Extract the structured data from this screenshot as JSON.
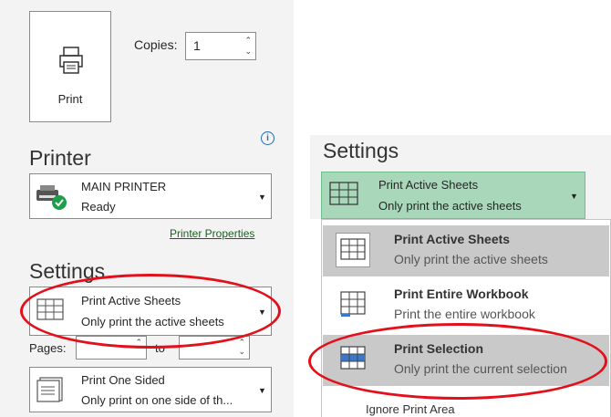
{
  "left": {
    "print_button_label": "Print",
    "copies_label": "Copies:",
    "copies_value": "1",
    "printer_heading": "Printer",
    "printer_name": "MAIN PRINTER",
    "printer_status": "Ready",
    "printer_properties_link": "Printer Properties",
    "settings_heading": "Settings",
    "active_sheets_title": "Print Active Sheets",
    "active_sheets_desc": "Only print the active sheets",
    "pages_label": "Pages:",
    "pages_from": "",
    "to_label": "to",
    "pages_to": "",
    "sided_title": "Print One Sided",
    "sided_desc": "Only print on one side of th..."
  },
  "right": {
    "settings_heading": "Settings",
    "selected_title": "Print Active Sheets",
    "selected_desc": "Only print the active sheets",
    "menu_items": [
      {
        "title": "Print Active Sheets",
        "desc": "Only print the active sheets"
      },
      {
        "title": "Print Entire Workbook",
        "desc": "Print the entire workbook"
      },
      {
        "title": "Print Selection",
        "desc": "Only print the current selection"
      }
    ],
    "ignore_print_area": "Ignore Print Area"
  },
  "colors": {
    "highlight_ellipse": "#e3101b",
    "selected_dropdown": "#a8d8b9",
    "menu_hover": "#c9c9c9",
    "link": "#1e5d1f"
  },
  "icons": [
    "printer-icon",
    "info-icon",
    "printer-ready-icon",
    "sheets-icon",
    "workbook-icon",
    "selection-icon",
    "one-sided-icon",
    "chevron-down-icon",
    "spin-up-icon",
    "spin-down-icon"
  ]
}
